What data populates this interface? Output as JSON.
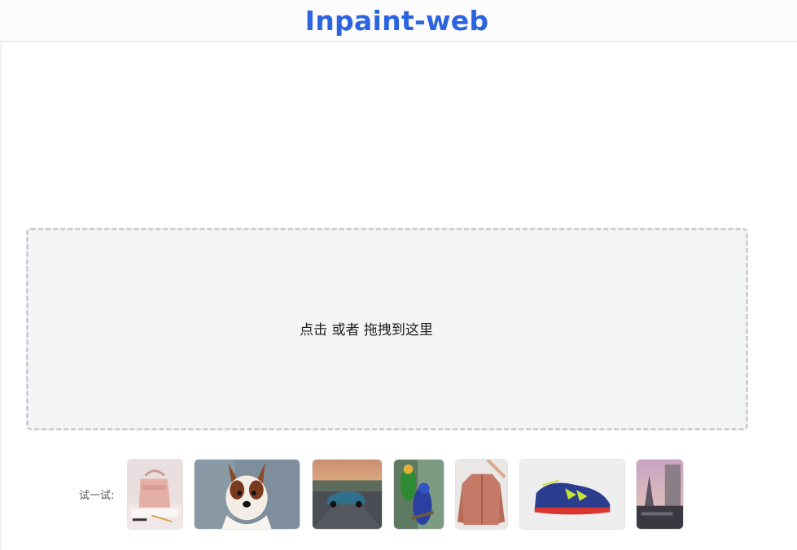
{
  "header": {
    "title": "Inpaint-web"
  },
  "dropzone": {
    "hint": "点击 或者 拖拽到这里"
  },
  "samples": {
    "label": "试一试:",
    "items": [
      {
        "name": "handbag",
        "icon": "handbag-photo"
      },
      {
        "name": "dog",
        "icon": "dog-photo"
      },
      {
        "name": "car",
        "icon": "car-photo"
      },
      {
        "name": "parrots",
        "icon": "parrots-photo"
      },
      {
        "name": "jacket",
        "icon": "jacket-photo"
      },
      {
        "name": "sneaker",
        "icon": "sneaker-photo"
      },
      {
        "name": "paris",
        "icon": "paris-photo"
      }
    ]
  },
  "colors": {
    "brand": "#2b63e0",
    "dropzone_bg": "#f3f4f6",
    "dropzone_border": "#d0d0d4"
  }
}
